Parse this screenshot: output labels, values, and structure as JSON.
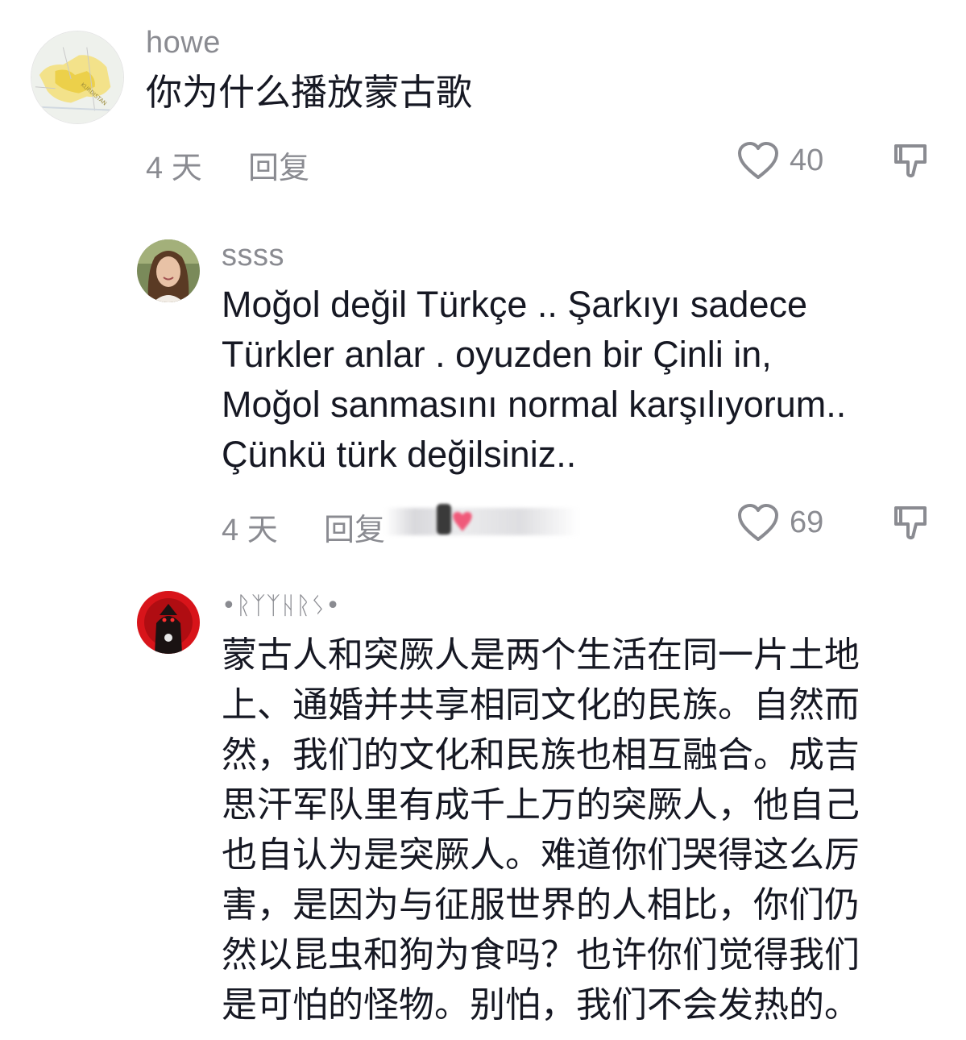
{
  "comments": [
    {
      "username": "howe",
      "text": "你为什么播放蒙古歌",
      "time": "4 天",
      "reply_label": "回复",
      "likes": "40",
      "avatar_icon": "map-avatar"
    },
    {
      "username": "ssss",
      "text_lines": [
        "Moğol değil Türkçe .. Şarkıyı sadece",
        "Türkler anlar . oyuzden bir Çinli in,",
        "Moğol sanmasını normal karşılıyorum..",
        "Çünkü türk değilsiniz.."
      ],
      "time": "4 天",
      "reply_label": "回复",
      "likes": "69",
      "avatar_icon": "person-photo-avatar"
    },
    {
      "username": "•ᚱᛉᛉᚺᚱᛊ•",
      "text_lines": [
        "蒙古人和突厥人是两个生活在同一片土地",
        "上、通婚并共享相同文化的民族。自然而",
        "然，我们的文化和民族也相互融合。成吉",
        "思汗军队里有成千上万的突厥人，他自己",
        "也自认为是突厥人。难道你们哭得这么厉",
        "害，是因为与征服世界的人相比，你们仍",
        "然以昆虫和狗为食吗？也许你们觉得我们",
        "是可怕的怪物。别怕，我们不会发热的。"
      ],
      "avatar_icon": "red-warrior-avatar"
    }
  ],
  "colors": {
    "text": "#161823",
    "muted": "#8a8b91",
    "background": "#ffffff"
  }
}
